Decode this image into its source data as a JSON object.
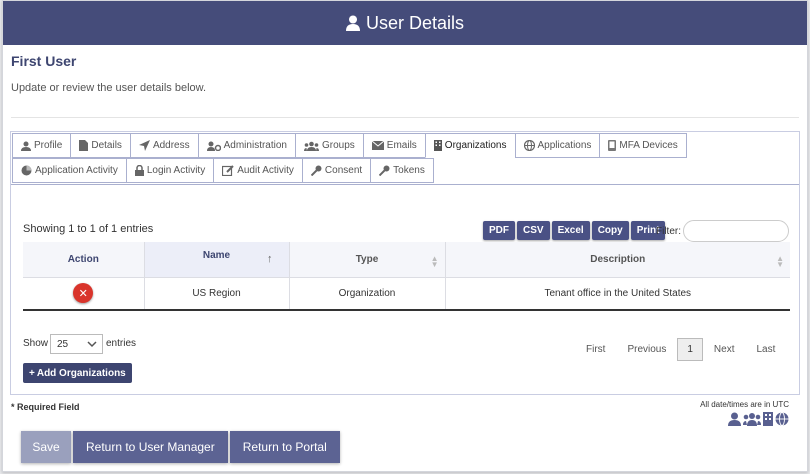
{
  "header": {
    "title": "User Details",
    "icon": "user-icon"
  },
  "user": {
    "name": "First User",
    "subtitle": "Update or review the user details below."
  },
  "tabs": {
    "row1": [
      {
        "label": "Profile",
        "icon": "user-icon"
      },
      {
        "label": "Details",
        "icon": "document-icon"
      },
      {
        "label": "Address",
        "icon": "location-arrow-icon"
      },
      {
        "label": "Administration",
        "icon": "user-cog-icon"
      },
      {
        "label": "Groups",
        "icon": "users-icon"
      },
      {
        "label": "Emails",
        "icon": "envelope-icon"
      },
      {
        "label": "Organizations",
        "icon": "building-icon",
        "active": true
      },
      {
        "label": "Applications",
        "icon": "globe-icon"
      },
      {
        "label": "MFA Devices",
        "icon": "device-icon"
      }
    ],
    "row2": [
      {
        "label": "Application Activity",
        "icon": "pie-chart-icon"
      },
      {
        "label": "Login Activity",
        "icon": "lock-icon"
      },
      {
        "label": "Audit Activity",
        "icon": "edit-icon"
      },
      {
        "label": "Consent",
        "icon": "key-icon"
      },
      {
        "label": "Tokens",
        "icon": "key-icon"
      }
    ]
  },
  "table": {
    "showing": "Showing 1 to 1 of 1 entries",
    "export_buttons": [
      "PDF",
      "CSV",
      "Excel",
      "Copy",
      "Print"
    ],
    "filter_label": "Filter:",
    "filter_value": "",
    "columns": [
      "Action",
      "Name",
      "Type",
      "Description"
    ],
    "rows": [
      {
        "name": "US Region",
        "type": "Organization",
        "description": "Tenant office in the United States"
      }
    ],
    "show_label": "Show",
    "page_length": "25",
    "entries_label": "entries",
    "pager": {
      "first": "First",
      "previous": "Previous",
      "current": "1",
      "next": "Next",
      "last": "Last"
    },
    "add_button": "Add Organizations"
  },
  "footer": {
    "required": "* Required Field",
    "utc_note": "All date/times are in UTC",
    "save": "Save",
    "return_manager": "Return to User Manager",
    "return_portal": "Return to Portal"
  },
  "colors": {
    "header_bg": "#454c7a",
    "button_dark": "#4a5185",
    "delete_red": "#d9342b"
  }
}
